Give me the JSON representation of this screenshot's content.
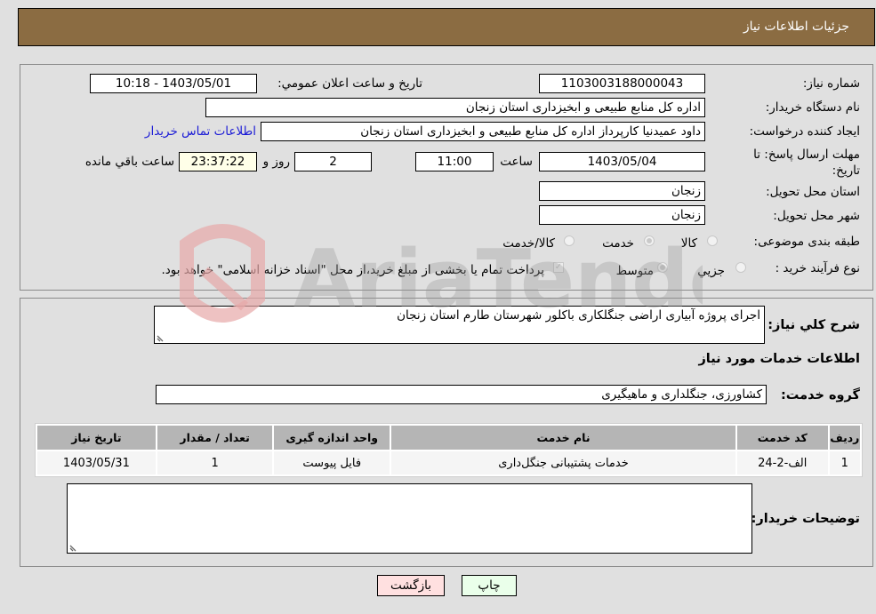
{
  "header": {
    "title": "جزئیات اطلاعات نیاز"
  },
  "colors": {
    "header_bg": "#8b6c42",
    "back_button_bg": "#ffe0e0",
    "print_button_bg": "#eaffea",
    "link": "#1a1ad6",
    "remaining_time_bg": "#ffffe8"
  },
  "form": {
    "need_number": {
      "label": "شماره نیاز:",
      "value": "1103003188000043"
    },
    "announce_datetime": {
      "label": "تاریخ و ساعت اعلان عمومي:",
      "value": "1403/05/01 - 10:18"
    },
    "buyer_org": {
      "label": "نام دستگاه خريدار:",
      "value": "اداره کل منابع طبیعی و ابخیزداری استان زنجان"
    },
    "requester": {
      "label": "ايجاد کننده درخواست:",
      "value": "داود عمیدنیا کارپرداز اداره کل منابع طبیعی و ابخیزداری استان زنجان",
      "contact_link": "اطلاعات تماس خريدار"
    },
    "deadline": {
      "label": "مهلت ارسال پاسخ: تا تاريخ:",
      "date": "1403/05/04",
      "time_label": "ساعت",
      "time": "11:00",
      "days": "2",
      "days_label": "روز و",
      "remaining": "23:37:22",
      "remaining_label": "ساعت باقي مانده"
    },
    "delivery_province": {
      "label": "استان محل تحويل:",
      "value": "زنجان"
    },
    "delivery_city": {
      "label": "شهر محل تحويل:",
      "value": "زنجان"
    },
    "category": {
      "label": "طبقه بندی موضوعی:",
      "options": [
        {
          "label": "کالا",
          "selected": false
        },
        {
          "label": "خدمت",
          "selected": true
        },
        {
          "label": "کالا/خدمت",
          "selected": false
        }
      ]
    },
    "process_type": {
      "label": "نوع فرآيند خريد :",
      "options": [
        {
          "label": "جزيي",
          "selected": false
        },
        {
          "label": "متوسط",
          "selected": true
        }
      ],
      "treasury_checkbox": {
        "label": "پرداخت تمام يا بخشی از مبلغ خريد،از محل \"اسناد خزانه اسلامی\" خواهد بود.",
        "checked": true
      }
    }
  },
  "details": {
    "description": {
      "label": "شرح کلي نياز:",
      "value": "اجرای پروژه آبیاری اراضی جنگلکاری باکلور شهرستان طارم استان زنجان"
    },
    "services_heading": "اطلاعات خدمات مورد نياز",
    "service_group": {
      "label": "گروه خدمت:",
      "value": "کشاورزی، جنگلداری و ماهیگیری"
    },
    "table": {
      "columns": [
        "رديف",
        "کد خدمت",
        "نام خدمت",
        "واحد اندازه گيری",
        "تعداد / مقدار",
        "تاریخ نیاز"
      ],
      "rows": [
        [
          "1",
          "الف-2-24",
          "خدمات پشتیبانی جنگل‌داری",
          "فایل پیوست",
          "1",
          "1403/05/31"
        ]
      ]
    },
    "buyer_notes": {
      "label": "توضيحات خريدار:",
      "value": ""
    }
  },
  "buttons": {
    "print": "چاپ",
    "back": "بازگشت"
  },
  "watermark": {
    "text": "AriaTender.net"
  }
}
